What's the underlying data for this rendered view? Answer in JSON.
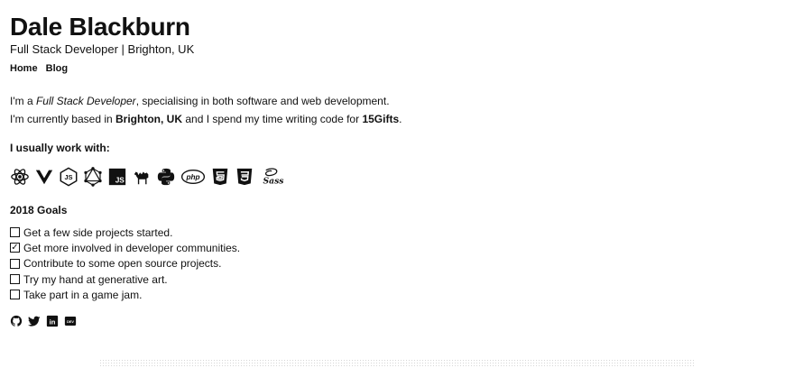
{
  "header": {
    "name": "Dale Blackburn",
    "subtitle": "Full Stack Developer | Brighton, UK"
  },
  "nav": [
    {
      "label": "Home"
    },
    {
      "label": "Blog"
    }
  ],
  "intro": {
    "line1_prefix": "I'm a ",
    "line1_role": "Full Stack Developer",
    "line1_suffix": ", specialising in both software and web development.",
    "line2_prefix": "I'm currently based in ",
    "line2_location": "Brighton, UK",
    "line2_middle": " and I spend my time writing code for ",
    "line2_company": "15Gifts",
    "line2_suffix": "."
  },
  "tech": {
    "title": "I usually work with:",
    "icons": [
      "react-icon",
      "vue-icon",
      "nodejs-icon",
      "graphql-icon",
      "javascript-icon",
      "perl-camel-icon",
      "python-icon",
      "php-icon",
      "html5-icon",
      "css3-icon",
      "sass-icon"
    ],
    "labels": {
      "js": "JS",
      "php": "php",
      "sass": "Sass"
    }
  },
  "goals": {
    "title": "2018 Goals",
    "items": [
      {
        "label": "Get a few side projects started.",
        "checked": false
      },
      {
        "label": "Get more involved in developer communities.",
        "checked": true
      },
      {
        "label": "Contribute to some open source projects.",
        "checked": false
      },
      {
        "label": "Try my hand at generative art.",
        "checked": false
      },
      {
        "label": "Take part in a game jam.",
        "checked": false
      }
    ],
    "checked_mark": "✓"
  },
  "social": {
    "icons": [
      "github-icon",
      "twitter-icon",
      "linkedin-icon",
      "dev-icon"
    ],
    "dev_label": "DEV",
    "linkedin_label": "in"
  }
}
